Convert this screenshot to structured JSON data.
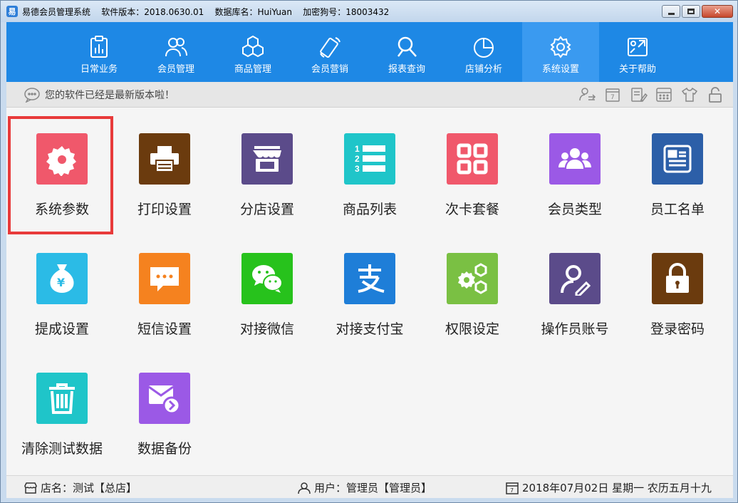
{
  "window": {
    "app_icon": "app-logo-icon",
    "title": "易德会员管理系统    软件版本：2018.0630.01    数据库名：HuiYuan    加密狗号：18003432",
    "close_glyph": "✕"
  },
  "nav": {
    "items": [
      {
        "label": "日常业务",
        "icon": "clipboard-chart-icon"
      },
      {
        "label": "会员管理",
        "icon": "members-icon"
      },
      {
        "label": "商品管理",
        "icon": "cubes-icon"
      },
      {
        "label": "会员营销",
        "icon": "phone-icon"
      },
      {
        "label": "报表查询",
        "icon": "search-report-icon"
      },
      {
        "label": "店铺分析",
        "icon": "pie-chart-icon"
      },
      {
        "label": "系统设置",
        "icon": "gear-icon"
      },
      {
        "label": "关于帮助",
        "icon": "help-icon"
      }
    ],
    "active_index": 6
  },
  "info": {
    "message": "您的软件已经是最新版本啦！"
  },
  "tiles": [
    {
      "label": "系统参数",
      "color": "#f0586b",
      "icon": "gear-icon"
    },
    {
      "label": "打印设置",
      "color": "#6b3b0e",
      "icon": "printer-icon"
    },
    {
      "label": "分店设置",
      "color": "#5b4b8a",
      "icon": "store-icon"
    },
    {
      "label": "商品列表",
      "color": "#1fc5c9",
      "icon": "numbered-list-icon"
    },
    {
      "label": "次卡套餐",
      "color": "#f0586b",
      "icon": "grid-icon"
    },
    {
      "label": "会员类型",
      "color": "#9b59e6",
      "icon": "user-group-icon"
    },
    {
      "label": "员工名单",
      "color": "#2c5fa8",
      "icon": "id-card-icon"
    },
    {
      "label": "提成设置",
      "color": "#2bbbe6",
      "icon": "money-bag-icon"
    },
    {
      "label": "短信设置",
      "color": "#f5821f",
      "icon": "sms-icon"
    },
    {
      "label": "对接微信",
      "color": "#27c21c",
      "icon": "wechat-icon"
    },
    {
      "label": "对接支付宝",
      "color": "#1e7ed8",
      "icon": "alipay-icon"
    },
    {
      "label": "权限设定",
      "color": "#7ac043",
      "icon": "gears-icon"
    },
    {
      "label": "操作员账号",
      "color": "#5b4b8a",
      "icon": "user-edit-icon"
    },
    {
      "label": "登录密码",
      "color": "#6b3b0e",
      "icon": "lock-icon"
    },
    {
      "label": "清除测试数据",
      "color": "#1fc5c9",
      "icon": "trash-icon"
    },
    {
      "label": "数据备份",
      "color": "#9b59e6",
      "icon": "mail-backup-icon"
    }
  ],
  "status": {
    "store": "店名：测试【总店】",
    "user": "用户：管理员【管理员】",
    "date": "2018年07月02日 星期一 农历五月十九"
  }
}
